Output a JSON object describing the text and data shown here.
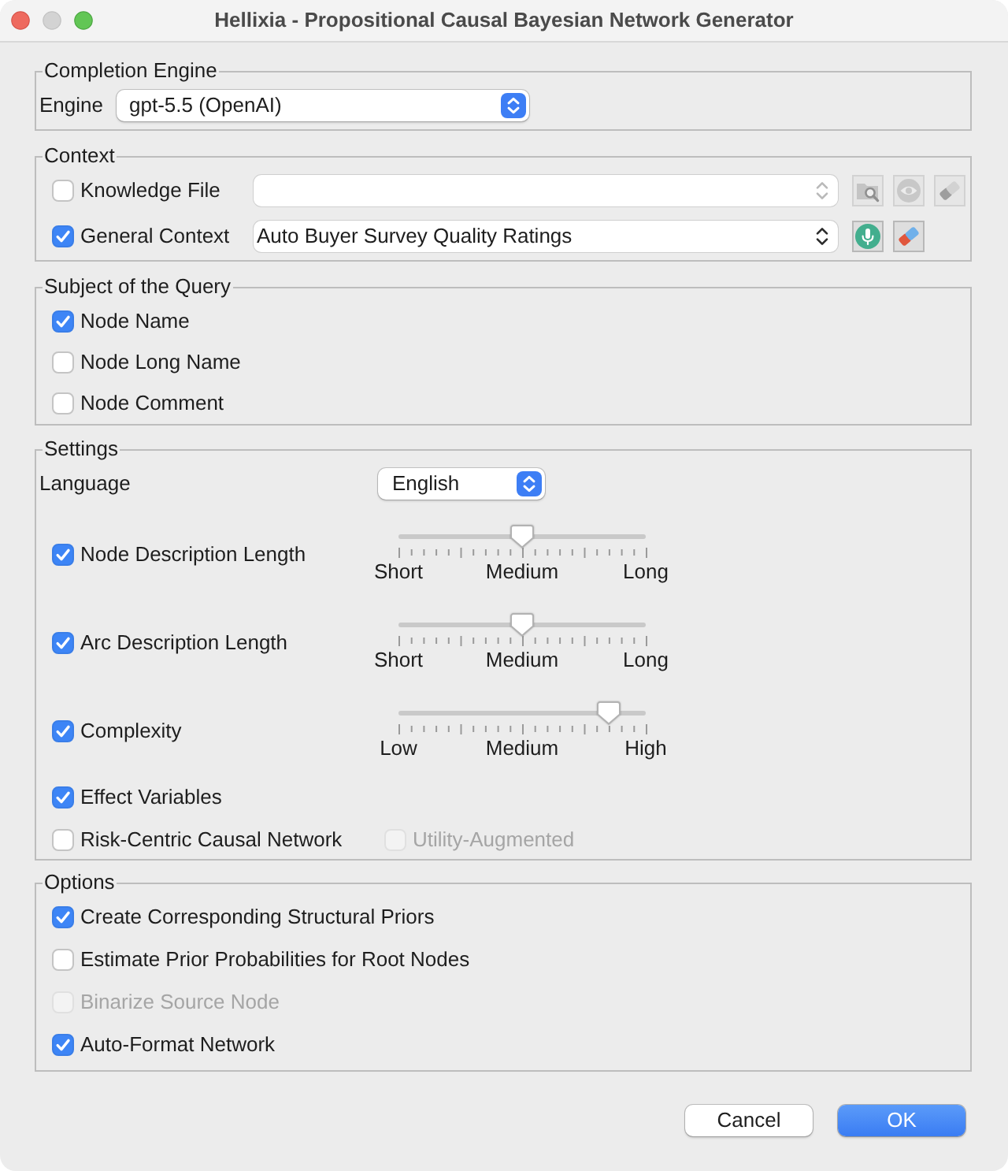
{
  "window": {
    "title": "Hellixia - Propositional Causal Bayesian Network Generator",
    "controls": [
      {
        "kind": "close",
        "disabled": false
      },
      {
        "kind": "minimize",
        "disabled": true
      },
      {
        "kind": "zoom",
        "disabled": false
      }
    ]
  },
  "completion_engine": {
    "title": "Completion Engine",
    "label": "Engine",
    "value": "gpt-5.5 (OpenAI)"
  },
  "context": {
    "title": "Context",
    "rows": [
      {
        "label": "Knowledge File",
        "checked": false,
        "field_disabled": true,
        "buttons": [
          {
            "kind": "browse",
            "disabled": true
          },
          {
            "kind": "view",
            "disabled": true
          },
          {
            "kind": "erase",
            "disabled": true
          }
        ]
      },
      {
        "label": "General Context",
        "checked": true,
        "value": "Auto Buyer Survey Quality Ratings",
        "field_disabled": false,
        "buttons": [
          {
            "kind": "voice",
            "disabled": false
          },
          {
            "kind": "erase",
            "disabled": false
          }
        ]
      }
    ]
  },
  "subject": {
    "title": "Subject of the Query",
    "items": [
      {
        "label": "Node Name",
        "checked": true
      },
      {
        "label": "Node Long Name",
        "checked": false
      },
      {
        "label": "Node Comment",
        "checked": false
      }
    ]
  },
  "settings": {
    "title": "Settings",
    "language": {
      "label": "Language",
      "value": "English"
    },
    "sliders": [
      {
        "label": "Node Description Length",
        "checked": true,
        "level": 0.5,
        "scale_labels": [
          "Short",
          "Medium",
          "Long"
        ]
      },
      {
        "label": "Arc Description Length",
        "checked": true,
        "level": 0.5,
        "scale_labels": [
          "Short",
          "Medium",
          "Long"
        ]
      },
      {
        "label": "Complexity",
        "checked": true,
        "level": 0.85,
        "scale_labels": [
          "Low",
          "Medium",
          "High"
        ]
      }
    ],
    "checks": [
      {
        "label": "Effect Variables",
        "checked": true,
        "disabled": false
      }
    ],
    "pair": [
      {
        "label": "Risk-Centric Causal Network",
        "checked": false,
        "disabled": false
      },
      {
        "label": "Utility-Augmented",
        "checked": false,
        "disabled": true
      }
    ]
  },
  "options": {
    "title": "Options",
    "items": [
      {
        "label": "Create Corresponding Structural Priors",
        "checked": true,
        "disabled": false
      },
      {
        "label": "Estimate Prior Probabilities for Root Nodes",
        "checked": false,
        "disabled": false
      },
      {
        "label": "Binarize Source Node",
        "checked": false,
        "disabled": true
      },
      {
        "label": "Auto-Format Network",
        "checked": true,
        "disabled": false
      }
    ]
  },
  "buttons": [
    {
      "label": "Cancel",
      "default": false
    },
    {
      "label": "OK",
      "default": true
    }
  ]
}
